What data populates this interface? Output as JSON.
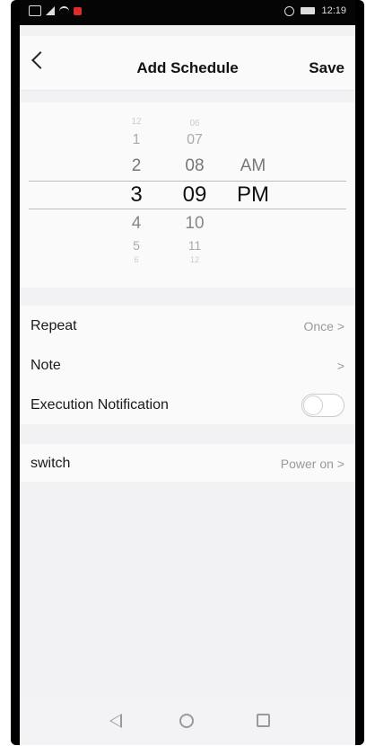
{
  "status_bar": {
    "time": "12:19"
  },
  "header": {
    "back_label": "<",
    "title": "Add Schedule",
    "save_label": "Save"
  },
  "time_picker": {
    "hour_options": [
      "12",
      "1",
      "2",
      "3",
      "4",
      "5",
      "6"
    ],
    "minute_options": [
      "06",
      "07",
      "08",
      "09",
      "10",
      "11",
      "12"
    ],
    "ampm_options": [
      "AM",
      "PM"
    ],
    "selected_hour": "3",
    "selected_minute": "09",
    "selected_ampm": "PM"
  },
  "settings": {
    "repeat": {
      "label": "Repeat",
      "value": "Once >"
    },
    "note": {
      "label": "Note",
      "value": ">"
    },
    "execution_notification": {
      "label": "Execution Notification",
      "enabled": false
    }
  },
  "action": {
    "switch": {
      "label": "switch",
      "value": "Power on >"
    }
  },
  "nav_bar": {
    "back": "◁",
    "home": "○",
    "recent": "□"
  }
}
